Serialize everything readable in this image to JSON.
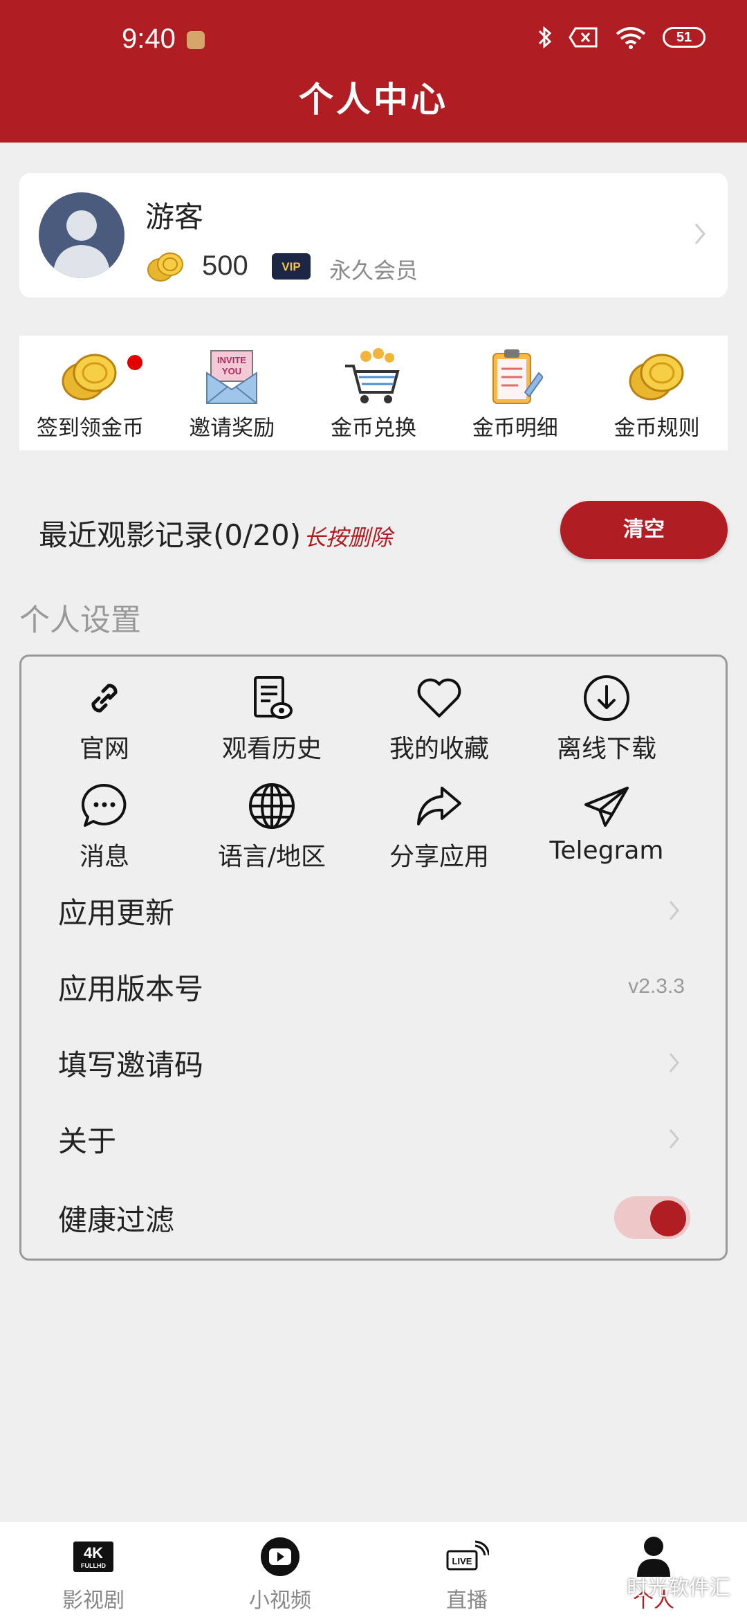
{
  "status_bar": {
    "time": "9:40",
    "battery": "51"
  },
  "header": {
    "title": "个人中心"
  },
  "profile": {
    "username": "游客",
    "coins": "500",
    "vip_badge": "VIP",
    "membership": "永久会员"
  },
  "quick_actions": [
    {
      "label": "签到领金币",
      "icon": "gold-coins-icon"
    },
    {
      "label": "邀请奖励",
      "icon": "invite-envelope-icon",
      "icon_text": "INVITE YOU"
    },
    {
      "label": "金币兑换",
      "icon": "shopping-cart-icon"
    },
    {
      "label": "金币明细",
      "icon": "clipboard-icon"
    },
    {
      "label": "金币规则",
      "icon": "gold-coins-icon"
    }
  ],
  "recent": {
    "title": "最近观影记录(0/20)",
    "hint": "长按删除",
    "clear_label": "清空"
  },
  "settings": {
    "section_title": "个人设置",
    "grid": [
      {
        "label": "官网",
        "icon": "link-icon"
      },
      {
        "label": "观看历史",
        "icon": "history-document-icon"
      },
      {
        "label": "我的收藏",
        "icon": "heart-icon"
      },
      {
        "label": "离线下载",
        "icon": "download-icon"
      },
      {
        "label": "消息",
        "icon": "message-icon"
      },
      {
        "label": "语言/地区",
        "icon": "globe-icon"
      },
      {
        "label": "分享应用",
        "icon": "share-icon"
      },
      {
        "label": "Telegram",
        "icon": "telegram-icon"
      }
    ],
    "rows": [
      {
        "label": "应用更新"
      },
      {
        "label": "应用版本号",
        "value": "v2.3.3"
      },
      {
        "label": "填写邀请码"
      },
      {
        "label": "关于"
      },
      {
        "label": "健康过滤",
        "toggle_on": true
      }
    ]
  },
  "bottom_nav": [
    {
      "label": "影视剧",
      "icon": "4k-icon",
      "icon_text": "4K",
      "icon_subtext": "FULLHD"
    },
    {
      "label": "小视频",
      "icon": "play-icon"
    },
    {
      "label": "直播",
      "icon": "live-icon",
      "icon_text": "LIVE"
    },
    {
      "label": "个人",
      "icon": "person-icon",
      "active": true
    }
  ],
  "watermark": "时光软件汇",
  "colors": {
    "brand": "#b01e23",
    "background": "#efefef"
  }
}
